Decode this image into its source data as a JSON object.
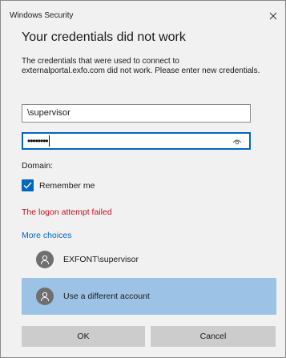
{
  "window": {
    "title": "Windows Security",
    "close_symbol": "✕"
  },
  "heading": "Your credentials did not work",
  "message": "The credentials that were used to connect to externalportal.exfo.com did not work. Please enter new credentials.",
  "username_field": {
    "value": "\\supervisor"
  },
  "password_field": {
    "masked_value": "••••••••",
    "reveal_icon": "eye-icon"
  },
  "domain_label": "Domain:",
  "remember_me": {
    "label": "Remember me",
    "checked": true
  },
  "error_text": "The logon attempt failed",
  "more_choices": "More choices",
  "accounts": [
    {
      "label": "EXFONT\\supervisor",
      "icon": "user-icon"
    },
    {
      "label": "Use a different account",
      "icon": "user-icon",
      "selected": true
    }
  ],
  "buttons": {
    "ok": "OK",
    "cancel": "Cancel"
  },
  "colors": {
    "accent": "#0067c0",
    "error": "#c50f1f",
    "selected_row": "#9cc3e5",
    "button": "#cccccc",
    "background": "#f1f1f1"
  }
}
